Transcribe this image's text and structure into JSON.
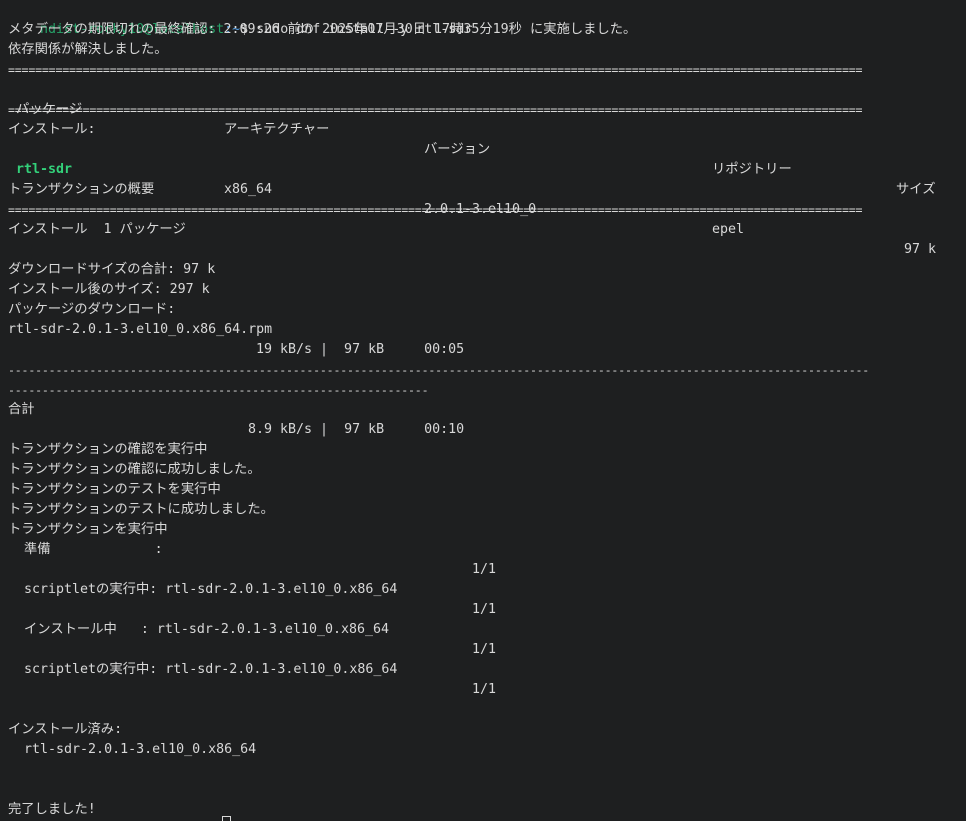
{
  "prompt": {
    "user_host": "ndict-rocky10@localhost",
    "path": ":~",
    "command": "$ sudo dnf install -y rtl-sdr"
  },
  "output": {
    "metadata_check": "メタデータの期限切れの最終確認: 2:09:26 前の 2025年07月30日 17時35分19秒 に実施しました。",
    "deps_resolved": "依存関係が解決しました。",
    "separator_eq": "==============================================================================================================================",
    "table_headers": {
      "package": "パッケージ",
      "arch": "アーキテクチャー",
      "version": "バージョン",
      "repo": "リポジトリー",
      "size": "サイズ"
    },
    "installing_label": "インストール:",
    "package_row": {
      "name": "rtl-sdr",
      "arch": "x86_64",
      "version": "2.0.1-3.el10_0",
      "repo": "epel",
      "size": "97 k"
    },
    "transaction_summary": "トランザクションの概要",
    "install_count": "インストール  1 パッケージ",
    "download_size": "ダウンロードサイズの合計: 97 k",
    "installed_size": "インストール後のサイズ: 297 k",
    "downloading": "パッケージのダウンロード:",
    "rpm_file": "rtl-sdr-2.0.1-3.el10_0.x86_64.rpm",
    "rpm_progress": "19 kB/s |  97 kB     00:05",
    "separator_dash_1": "-------------------------------------------------------------------------------------------------------------------------------",
    "separator_dash_2": "--------------------------------------------------------------",
    "total_label": "合計",
    "total_progress": "8.9 kB/s |  97 kB     00:10",
    "tx_check_running": "トランザクションの確認を実行中",
    "tx_check_ok": "トランザクションの確認に成功しました。",
    "tx_test_running": "トランザクションのテストを実行中",
    "tx_test_ok": "トランザクションのテストに成功しました。",
    "tx_running": "トランザクションを実行中",
    "step_prepare": "  準備             :",
    "step_counter": "1/1",
    "step_scriptlet_1": "  scriptletの実行中: rtl-sdr-2.0.1-3.el10_0.x86_64",
    "step_install": "  インストール中   : rtl-sdr-2.0.1-3.el10_0.x86_64",
    "step_scriptlet_2": "  scriptletの実行中: rtl-sdr-2.0.1-3.el10_0.x86_64",
    "installed_label": "インストール済み:",
    "installed_pkg": "  rtl-sdr-2.0.1-3.el10_0.x86_64",
    "complete": "完了しました!"
  },
  "colors": {
    "background": "#1e1f20",
    "text": "#d8d8d8",
    "prompt_user": "#26a269",
    "prompt_path": "#5aa3e6",
    "package_highlight": "#33d17a"
  }
}
